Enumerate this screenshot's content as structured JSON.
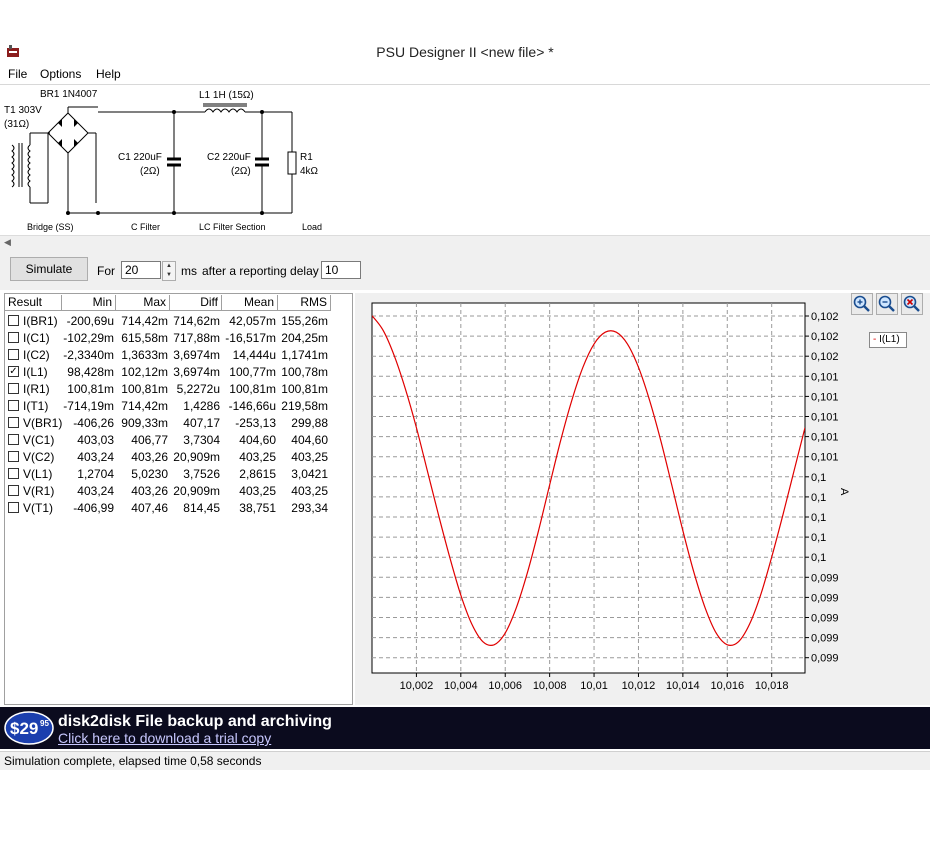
{
  "window": {
    "title": "PSU Designer II  <new file> *"
  },
  "menu": {
    "items": [
      "File",
      "Options",
      "Help"
    ]
  },
  "schematic": {
    "bridge_part": "BR1 1N4007",
    "transformer_label": "T1 303V",
    "transformer_resistance": "(31Ω)",
    "inductor_label": "L1 1H (15Ω)",
    "c1_label": "C1 220uF",
    "c1_esr": "(2Ω)",
    "c2_label": "C2 220uF",
    "c2_esr": "(2Ω)",
    "r1_label": "R1",
    "r1_value": "4kΩ",
    "sections": [
      "Bridge (SS)",
      "C Filter",
      "LC Filter Section",
      "Load"
    ]
  },
  "controls": {
    "simulate_label": "Simulate",
    "for_label": "For",
    "duration_value": "20",
    "ms_label": "ms",
    "delay_label": "after a reporting delay of",
    "delay_value": "10"
  },
  "results": {
    "columns": [
      "Result",
      "Min",
      "Max",
      "Diff",
      "Mean",
      "RMS"
    ],
    "rows": [
      {
        "name": "I(BR1)",
        "checked": false,
        "min": "-200,69u",
        "max": "714,42m",
        "diff": "714,62m",
        "mean": "42,057m",
        "rms": "155,26m"
      },
      {
        "name": "I(C1)",
        "checked": false,
        "min": "-102,29m",
        "max": "615,58m",
        "diff": "717,88m",
        "mean": "-16,517m",
        "rms": "204,25m"
      },
      {
        "name": "I(C2)",
        "checked": false,
        "min": "-2,3340m",
        "max": "1,3633m",
        "diff": "3,6974m",
        "mean": "14,444u",
        "rms": "1,1741m"
      },
      {
        "name": "I(L1)",
        "checked": true,
        "min": "98,428m",
        "max": "102,12m",
        "diff": "3,6974m",
        "mean": "100,77m",
        "rms": "100,78m"
      },
      {
        "name": "I(R1)",
        "checked": false,
        "min": "100,81m",
        "max": "100,81m",
        "diff": "5,2272u",
        "mean": "100,81m",
        "rms": "100,81m"
      },
      {
        "name": "I(T1)",
        "checked": false,
        "min": "-714,19m",
        "max": "714,42m",
        "diff": "1,4286",
        "mean": "-146,66u",
        "rms": "219,58m"
      },
      {
        "name": "V(BR1)",
        "checked": false,
        "min": "-406,26",
        "max": "909,33m",
        "diff": "407,17",
        "mean": "-253,13",
        "rms": "299,88"
      },
      {
        "name": "V(C1)",
        "checked": false,
        "min": "403,03",
        "max": "406,77",
        "diff": "3,7304",
        "mean": "404,60",
        "rms": "404,60"
      },
      {
        "name": "V(C2)",
        "checked": false,
        "min": "403,24",
        "max": "403,26",
        "diff": "20,909m",
        "mean": "403,25",
        "rms": "403,25"
      },
      {
        "name": "V(L1)",
        "checked": false,
        "min": "1,2704",
        "max": "5,0230",
        "diff": "3,7526",
        "mean": "2,8615",
        "rms": "3,0421"
      },
      {
        "name": "V(R1)",
        "checked": false,
        "min": "403,24",
        "max": "403,26",
        "diff": "20,909m",
        "mean": "403,25",
        "rms": "403,25"
      },
      {
        "name": "V(T1)",
        "checked": false,
        "min": "-406,99",
        "max": "407,46",
        "diff": "814,45",
        "mean": "38,751",
        "rms": "293,34"
      }
    ]
  },
  "chart_data": {
    "type": "line",
    "title": "",
    "xlabel": "",
    "ylabel": "A",
    "x_ticks": [
      "10,002",
      "10,004",
      "10,006",
      "10,008",
      "10,01",
      "10,012",
      "10,014",
      "10,016",
      "10,018"
    ],
    "y_ticks": [
      "0,102",
      "0,102",
      "0,102",
      "0,101",
      "0,101",
      "0,101",
      "0,101",
      "0,101",
      "0,1",
      "0,1",
      "0,1",
      "0,1",
      "0,1",
      "0,099",
      "0,099",
      "0,099",
      "0,099",
      "0,099"
    ],
    "xlim": [
      10.0,
      10.0195
    ],
    "ylim": [
      0.09832,
      0.10212
    ],
    "grid": true,
    "legend_position": "top-right",
    "series": [
      {
        "name": "I(L1)",
        "color": "#e00000",
        "x": [
          10.0,
          10.0005,
          10.001,
          10.0015,
          10.002,
          10.0025,
          10.003,
          10.0035,
          10.004,
          10.0045,
          10.005,
          10.0055,
          10.006,
          10.0065,
          10.007,
          10.0075,
          10.008,
          10.0085,
          10.009,
          10.0095,
          10.01,
          10.0105,
          10.011,
          10.0115,
          10.012,
          10.0125,
          10.013,
          10.0135,
          10.014,
          10.0145,
          10.015,
          10.0155,
          10.016,
          10.0165,
          10.017,
          10.0175,
          10.018,
          10.0185,
          10.019,
          10.0195
        ],
        "y": [
          0.10199,
          0.10184,
          0.10158,
          0.10124,
          0.10084,
          0.10039,
          0.09994,
          0.09951,
          0.09912,
          0.09882,
          0.09864,
          0.09861,
          0.09873,
          0.09899,
          0.09935,
          0.09978,
          0.10025,
          0.10071,
          0.10112,
          0.10146,
          0.1017,
          0.10182,
          0.10182,
          0.1017,
          0.10146,
          0.10112,
          0.10071,
          0.10025,
          0.09978,
          0.09935,
          0.09899,
          0.09873,
          0.09861,
          0.09864,
          0.09882,
          0.09912,
          0.09951,
          0.09994,
          0.10039,
          0.10084
        ]
      }
    ]
  },
  "banner": {
    "price": "$29",
    "price_cents": "95",
    "title": "disk2disk File backup and archiving",
    "link": "Click here to download a trial copy"
  },
  "status": {
    "text": "Simulation complete, elapsed time 0,58 seconds"
  }
}
